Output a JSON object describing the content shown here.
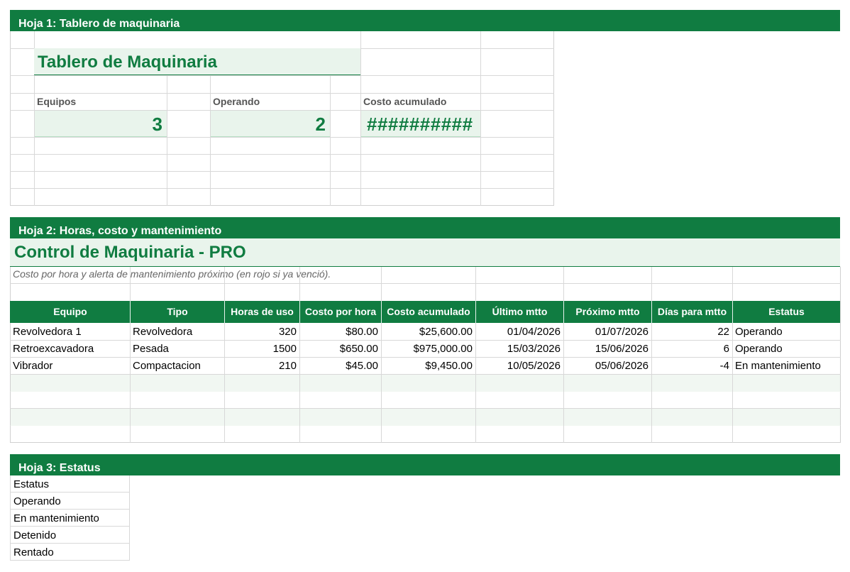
{
  "sheet1": {
    "bar_label": "Hoja 1: Tablero de maquinaria",
    "title": "Tablero de Maquinaria",
    "kpis": [
      {
        "label": "Equipos",
        "value": "3"
      },
      {
        "label": "Operando",
        "value": "2"
      },
      {
        "label": "Costo acumulado",
        "value": "##########"
      }
    ]
  },
  "sheet2": {
    "bar_label": "Hoja 2: Horas, costo y mantenimiento",
    "title": "Control de Maquinaria - PRO",
    "subtitle": "Costo por hora y alerta de mantenimiento próximo (en rojo si ya venció).",
    "columns": [
      "Equipo",
      "Tipo",
      "Horas de uso",
      "Costo por hora",
      "Costo acumulado",
      "Último mtto",
      "Próximo mtto",
      "Días para mtto",
      "Estatus"
    ],
    "rows": [
      [
        "Revolvedora 1",
        "Revolvedora",
        "320",
        "$80.00",
        "$25,600.00",
        "01/04/2026",
        "01/07/2026",
        "22",
        "Operando"
      ],
      [
        "Retroexcavadora",
        "Pesada",
        "1500",
        "$650.00",
        "$975,000.00",
        "15/03/2026",
        "15/06/2026",
        "6",
        "Operando"
      ],
      [
        "Vibrador",
        "Compactacion",
        "210",
        "$45.00",
        "$9,450.00",
        "10/05/2026",
        "05/06/2026",
        "-4",
        "En mantenimiento"
      ]
    ]
  },
  "sheet3": {
    "bar_label": "Hoja 3: Estatus",
    "items": [
      "Estatus",
      "Operando",
      "En mantenimiento",
      "Detenido",
      "Rentado"
    ]
  },
  "colors": {
    "brand_green": "#107c41",
    "light_green": "#e9f4ec"
  }
}
